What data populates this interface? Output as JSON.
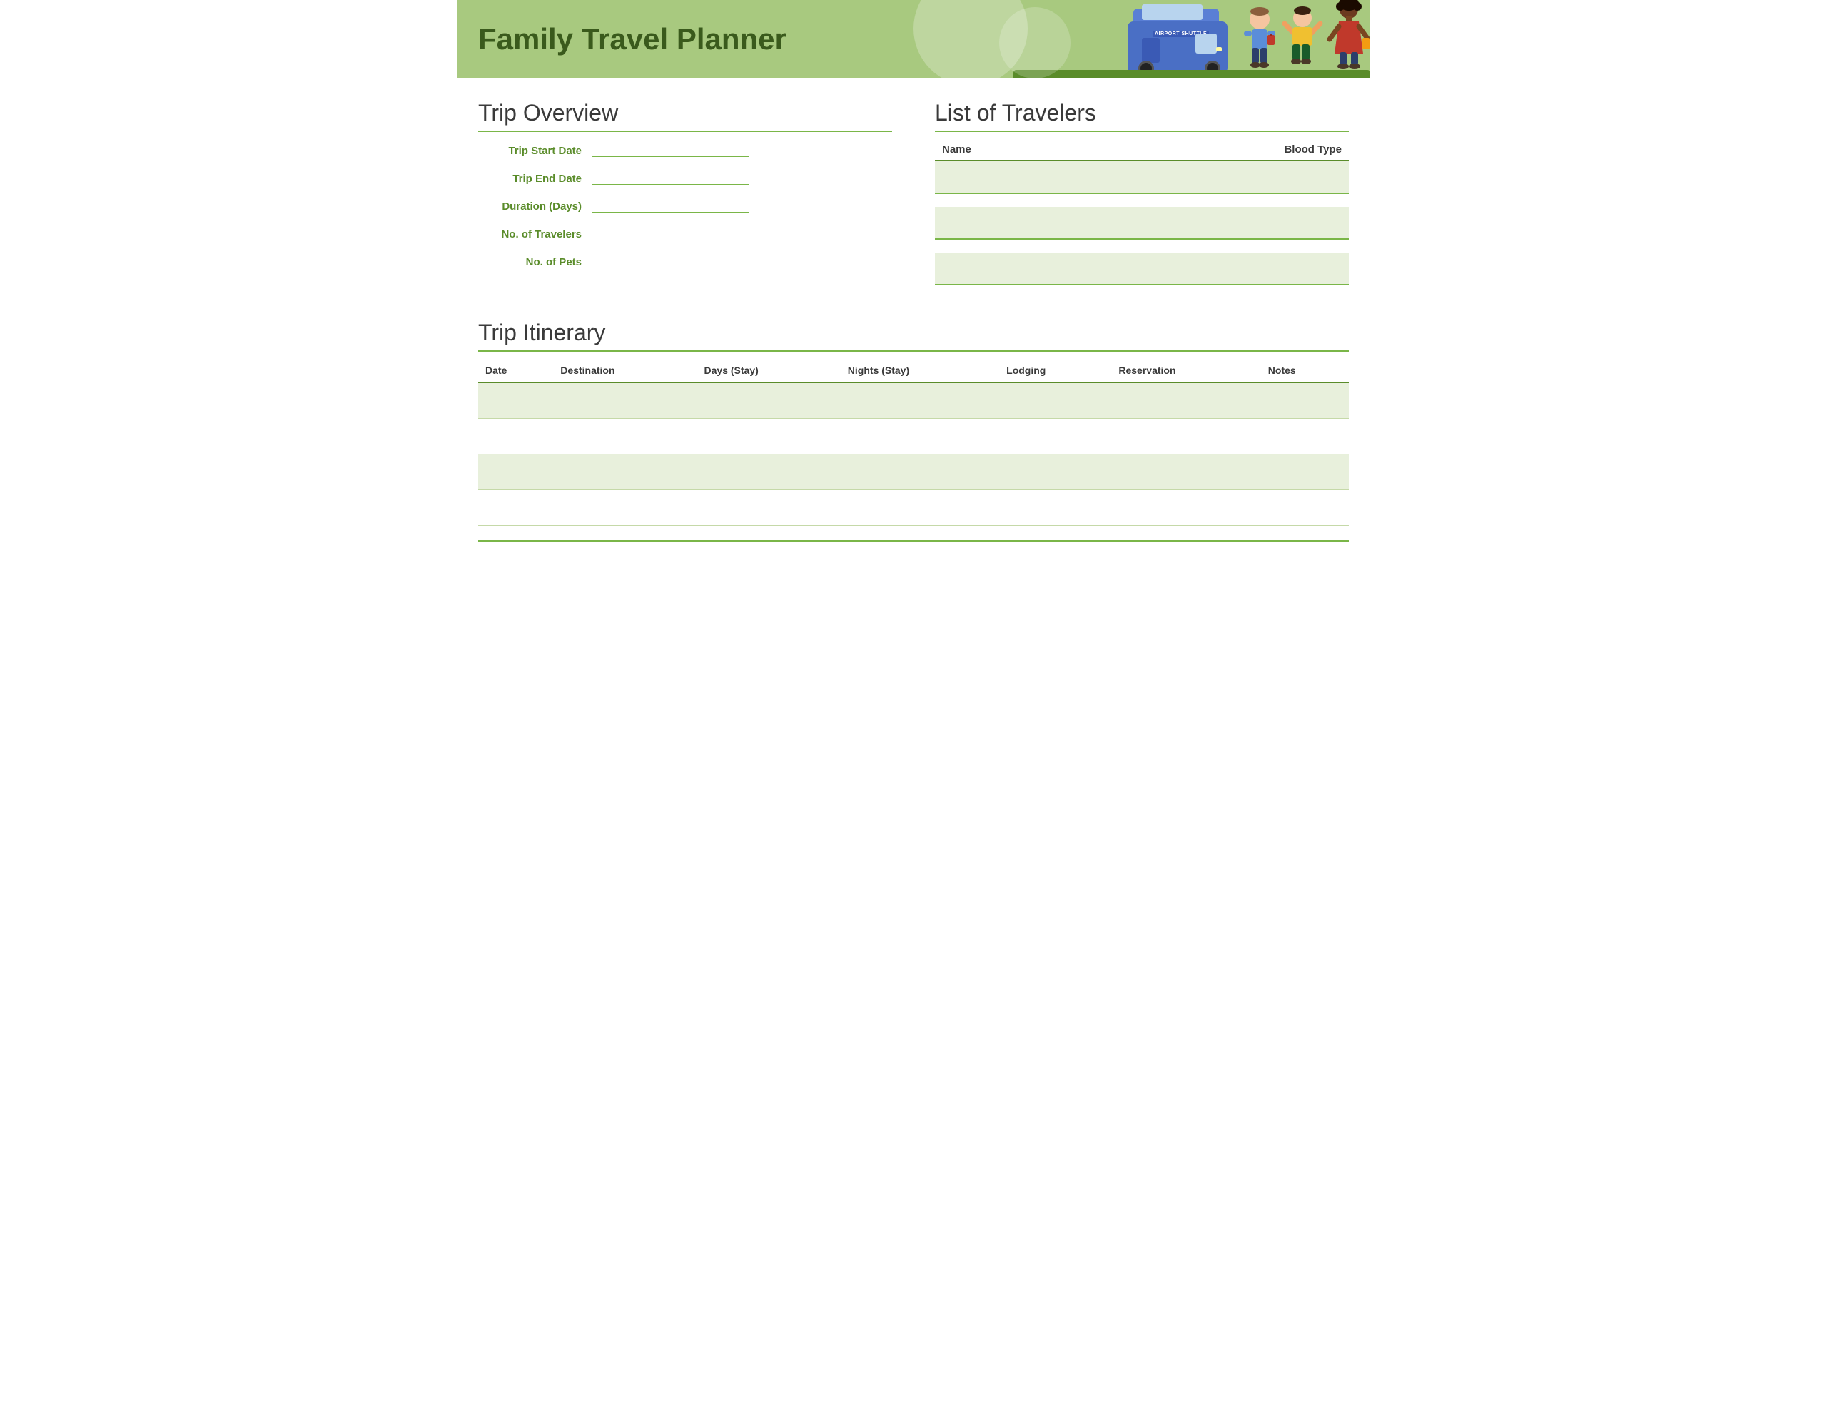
{
  "header": {
    "title": "Family Travel Planner",
    "bus_label": "AIRPORT SHUTTLE"
  },
  "trip_overview": {
    "section_title": "Trip Overview",
    "fields": [
      {
        "label": "Trip Start Date",
        "id": "trip-start-date"
      },
      {
        "label": "Trip End Date",
        "id": "trip-end-date"
      },
      {
        "label": "Duration (Days)",
        "id": "duration-days"
      },
      {
        "label": "No. of Travelers",
        "id": "no-of-travelers"
      },
      {
        "label": "No. of Pets",
        "id": "no-of-pets"
      }
    ]
  },
  "list_of_travelers": {
    "section_title": "List of Travelers",
    "columns": [
      "Name",
      "Blood Type"
    ],
    "rows": [
      {
        "name": "",
        "blood_type": ""
      },
      {
        "name": "",
        "blood_type": ""
      },
      {
        "name": "",
        "blood_type": ""
      }
    ]
  },
  "trip_itinerary": {
    "section_title": "Trip Itinerary",
    "columns": [
      "Date",
      "Destination",
      "Days (Stay)",
      "Nights (Stay)",
      "Lodging",
      "Reservation",
      "Notes"
    ],
    "rows": [
      {
        "date": "",
        "destination": "",
        "days_stay": "",
        "nights_stay": "",
        "lodging": "",
        "reservation": "",
        "notes": ""
      },
      {
        "date": "",
        "destination": "",
        "days_stay": "",
        "nights_stay": "",
        "lodging": "",
        "reservation": "",
        "notes": ""
      },
      {
        "date": "",
        "destination": "",
        "days_stay": "",
        "nights_stay": "",
        "lodging": "",
        "reservation": "",
        "notes": ""
      },
      {
        "date": "",
        "destination": "",
        "days_stay": "",
        "nights_stay": "",
        "lodging": "",
        "reservation": "",
        "notes": ""
      }
    ]
  },
  "colors": {
    "header_bg": "#a8c97f",
    "green_accent": "#7ab648",
    "dark_green": "#5a8c2a",
    "text_green": "#5a8c2a",
    "row_shaded": "#e8f0dc"
  }
}
